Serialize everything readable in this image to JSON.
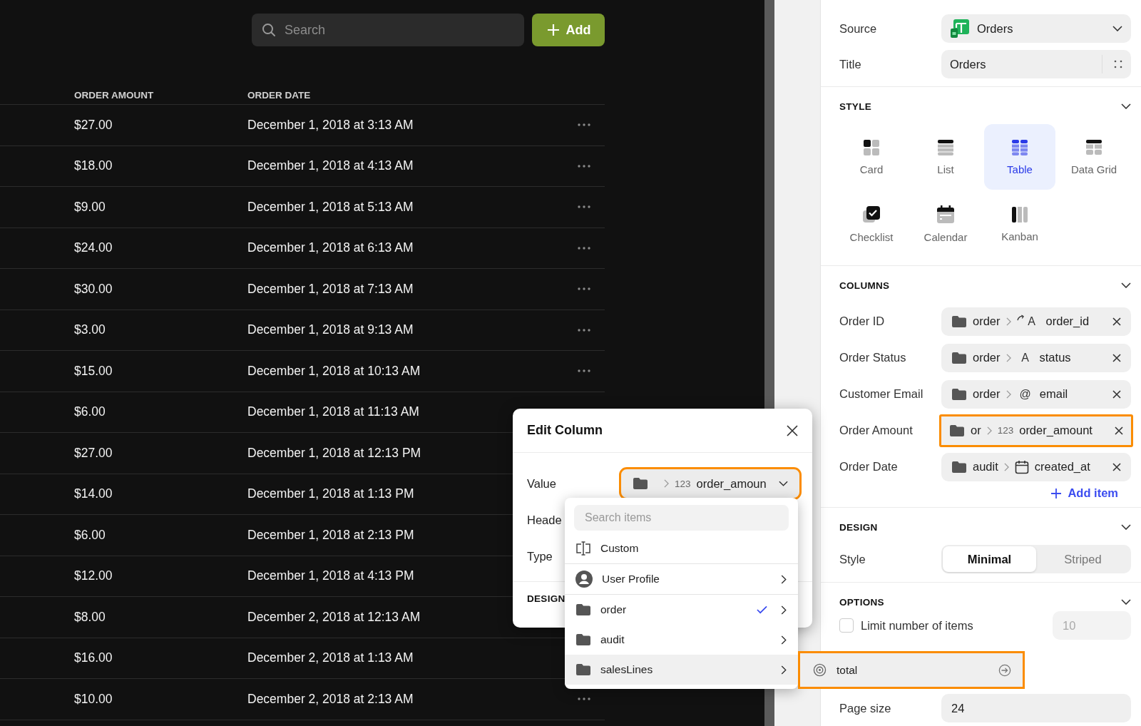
{
  "toolbar": {
    "search": {
      "placeholder": "Search"
    },
    "add_button": "Add"
  },
  "table": {
    "columns": [
      "ORDER AMOUNT",
      "ORDER DATE"
    ],
    "rows": [
      {
        "amount": "$27.00",
        "date": "December 1, 2018 at 3:13 AM"
      },
      {
        "amount": "$18.00",
        "date": "December 1, 2018 at 4:13 AM"
      },
      {
        "amount": "$9.00",
        "date": "December 1, 2018 at 5:13 AM"
      },
      {
        "amount": "$24.00",
        "date": "December 1, 2018 at 6:13 AM"
      },
      {
        "amount": "$30.00",
        "date": "December 1, 2018 at 7:13 AM"
      },
      {
        "amount": "$3.00",
        "date": "December 1, 2018 at 9:13 AM"
      },
      {
        "amount": "$15.00",
        "date": "December 1, 2018 at 10:13 AM"
      },
      {
        "amount": "$6.00",
        "date": "December 1, 2018 at 11:13 AM"
      },
      {
        "amount": "$27.00",
        "date": "December 1, 2018 at 12:13 PM"
      },
      {
        "amount": "$14.00",
        "date": "December 1, 2018 at 1:13 PM"
      },
      {
        "amount": "$6.00",
        "date": "December 1, 2018 at 2:13 PM"
      },
      {
        "amount": "$12.00",
        "date": "December 1, 2018 at 4:13 PM"
      },
      {
        "amount": "$8.00",
        "date": "December 2, 2018 at 12:13 AM"
      },
      {
        "amount": "$16.00",
        "date": "December 2, 2018 at 1:13 AM"
      },
      {
        "amount": "$10.00",
        "date": "December 2, 2018 at 2:13 AM"
      }
    ]
  },
  "edit_column": {
    "title": "Edit Column",
    "fields": [
      {
        "label": "Value",
        "kind": "select",
        "value": {
          "type_glyph": "123",
          "field": "order_amoun",
          "highlighted": true
        }
      },
      {
        "label": "Heade",
        "kind": "blank"
      },
      {
        "label": "Type",
        "kind": "blank"
      }
    ],
    "section": "DESIGN",
    "menu": {
      "search": {
        "placeholder": "Search items"
      },
      "items": [
        {
          "kind": "custom",
          "label": "Custom",
          "checked": false,
          "highlighted": false
        },
        {
          "kind": "profile",
          "label": "User Profile",
          "checked": false,
          "highlighted": false
        },
        {
          "kind": "folder",
          "label": "order",
          "checked": true,
          "highlighted": false
        },
        {
          "kind": "folder",
          "label": "audit",
          "checked": false,
          "highlighted": false
        },
        {
          "kind": "folder",
          "label": "salesLines",
          "checked": false,
          "highlighted": true
        }
      ]
    },
    "submenu": {
      "label": "total",
      "highlighted": true
    }
  },
  "panel": {
    "source": {
      "label": "Source",
      "value": "Orders"
    },
    "title": {
      "label": "Title",
      "value": "Orders"
    },
    "style": {
      "heading": "STYLE",
      "options": [
        {
          "kind": "card",
          "label": "Card",
          "selected": false
        },
        {
          "kind": "list",
          "label": "List",
          "selected": false
        },
        {
          "kind": "table",
          "label": "Table",
          "selected": true
        },
        {
          "kind": "datagrid",
          "label": "Data Grid",
          "selected": false
        },
        {
          "kind": "checklist",
          "label": "Checklist",
          "selected": false
        },
        {
          "kind": "calendar",
          "label": "Calendar",
          "selected": false
        },
        {
          "kind": "kanban",
          "label": "Kanban",
          "selected": false
        }
      ]
    },
    "columns": {
      "heading": "COLUMNS",
      "items": [
        {
          "label": "Order ID",
          "parent": "order",
          "kind": "id",
          "type_glyph": "A",
          "field": "order_id",
          "highlighted": false
        },
        {
          "label": "Order Status",
          "parent": "order",
          "kind": "text",
          "type_glyph": "A",
          "field": "status",
          "highlighted": false
        },
        {
          "label": "Customer Email",
          "parent": "order",
          "kind": "email",
          "type_glyph": "@",
          "field": "email",
          "highlighted": false
        },
        {
          "label": "Order Amount",
          "parent": "or",
          "kind": "number",
          "type_glyph": "123",
          "field": "order_amount",
          "highlighted": true
        },
        {
          "label": "Order Date",
          "parent": "audit",
          "kind": "date",
          "field": "created_at",
          "highlighted": false
        }
      ],
      "add_item": "Add item"
    },
    "design": {
      "heading": "DESIGN",
      "label": "Style",
      "segments": [
        {
          "label": "Minimal",
          "selected": true
        },
        {
          "label": "Striped",
          "selected": false
        }
      ]
    },
    "options": {
      "heading": "OPTIONS",
      "limit": {
        "label": "Limit number of items",
        "checked": false,
        "placeholder": "10"
      },
      "page_size": {
        "label": "Page size",
        "value": "24"
      }
    }
  }
}
